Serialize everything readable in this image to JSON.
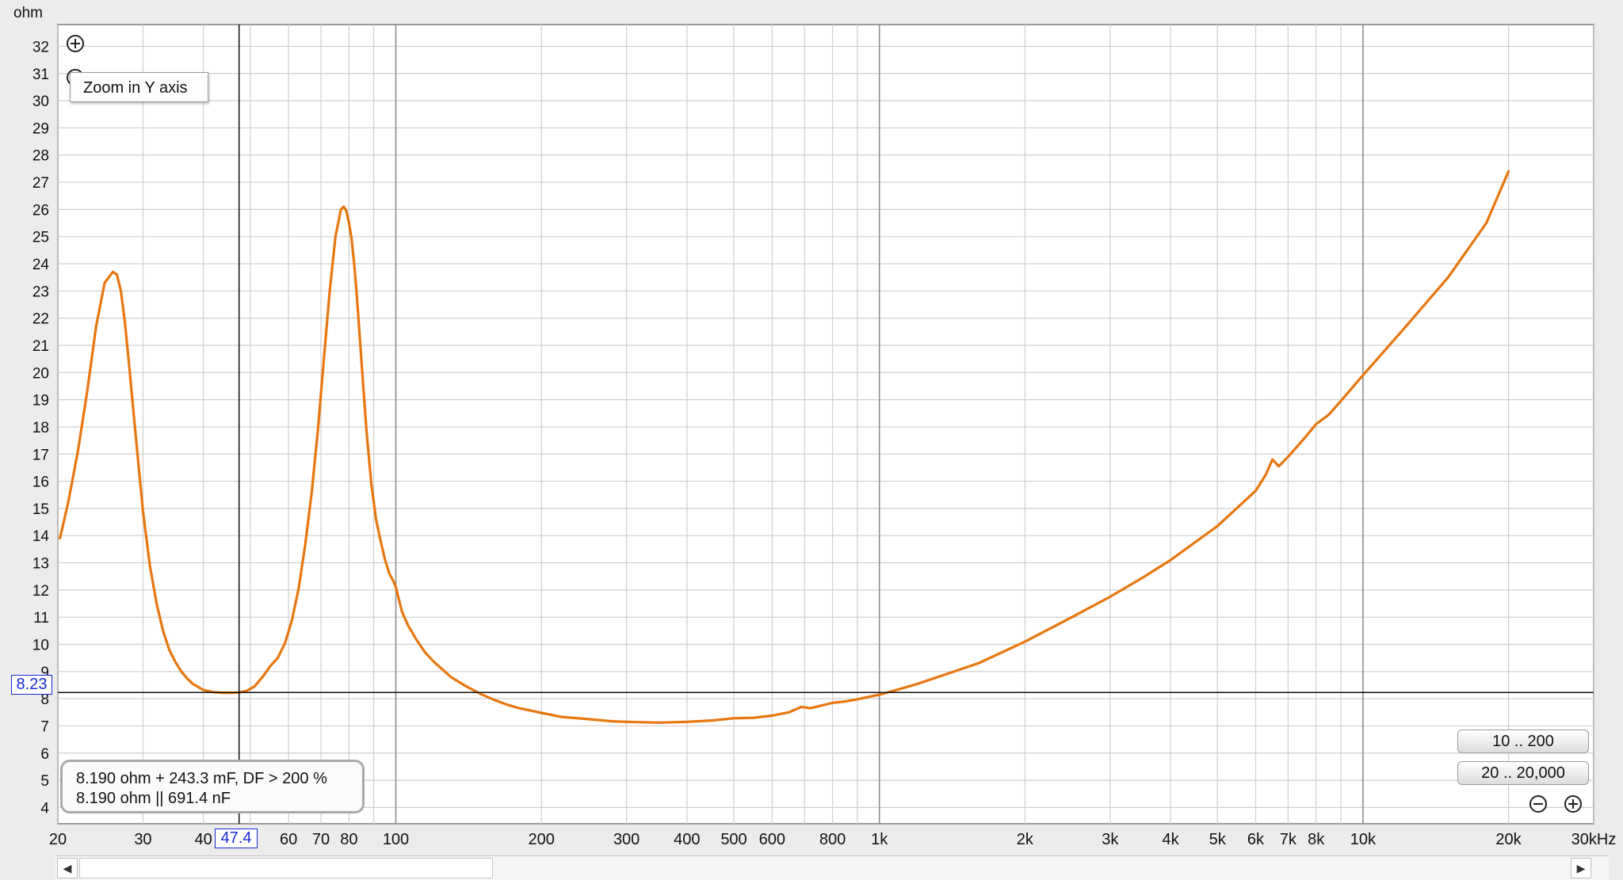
{
  "chart_data": {
    "type": "line",
    "y_unit": "ohm",
    "x_unit": "kHz",
    "x_scale": "log",
    "xlim": [
      20,
      30000
    ],
    "ylim": [
      3.4,
      32.8
    ],
    "grid": true,
    "y_ticks": [
      4,
      5,
      6,
      7,
      8,
      9,
      10,
      11,
      12,
      13,
      14,
      15,
      16,
      17,
      18,
      19,
      20,
      21,
      22,
      23,
      24,
      25,
      26,
      27,
      28,
      29,
      30,
      31,
      32
    ],
    "x_ticks": [
      {
        "value": 20,
        "label": "20"
      },
      {
        "value": 30,
        "label": "30"
      },
      {
        "value": 40,
        "label": "40"
      },
      {
        "value": 60,
        "label": "60"
      },
      {
        "value": 70,
        "label": "70"
      },
      {
        "value": 80,
        "label": "80"
      },
      {
        "value": 100,
        "label": "100"
      },
      {
        "value": 200,
        "label": "200"
      },
      {
        "value": 300,
        "label": "300"
      },
      {
        "value": 400,
        "label": "400"
      },
      {
        "value": 500,
        "label": "500"
      },
      {
        "value": 600,
        "label": "600"
      },
      {
        "value": 800,
        "label": "800"
      },
      {
        "value": 1000,
        "label": "1k"
      },
      {
        "value": 2000,
        "label": "2k"
      },
      {
        "value": 3000,
        "label": "3k"
      },
      {
        "value": 4000,
        "label": "4k"
      },
      {
        "value": 5000,
        "label": "5k"
      },
      {
        "value": 6000,
        "label": "6k"
      },
      {
        "value": 7000,
        "label": "7k"
      },
      {
        "value": 8000,
        "label": "8k"
      },
      {
        "value": 10000,
        "label": "10k"
      },
      {
        "value": 20000,
        "label": "20k"
      },
      {
        "value": 30000,
        "label": "30kHz"
      }
    ],
    "series": [
      {
        "color": "#e8760f",
        "x": [
          20.2,
          21,
          22,
          23,
          24,
          25,
          26,
          26.5,
          27,
          27.5,
          28,
          29,
          30,
          31,
          32,
          33,
          34,
          35,
          36,
          37,
          38,
          40,
          42,
          44,
          46,
          47.4,
          49,
          51,
          53,
          55,
          57,
          59,
          61,
          63,
          65,
          67,
          69,
          71,
          73,
          75,
          77,
          78,
          79,
          80,
          81,
          82,
          83,
          85,
          87,
          89,
          91,
          93,
          95,
          97,
          99,
          100,
          103,
          106,
          110,
          115,
          120,
          130,
          140,
          150,
          160,
          170,
          180,
          200,
          220,
          250,
          280,
          300,
          350,
          400,
          450,
          500,
          550,
          600,
          650,
          690,
          720,
          760,
          800,
          850,
          900,
          1000,
          1100,
          1200,
          1400,
          1600,
          2000,
          2500,
          3000,
          3500,
          4000,
          5000,
          6000,
          6300,
          6500,
          6700,
          7000,
          7500,
          8000,
          8500,
          9000,
          10000,
          12000,
          15000,
          18000,
          20000
        ],
        "y": [
          13.9,
          15.2,
          17.1,
          19.3,
          21.7,
          23.3,
          23.7,
          23.6,
          23.0,
          21.9,
          20.5,
          17.6,
          14.9,
          12.9,
          11.5,
          10.5,
          9.8,
          9.35,
          9.0,
          8.75,
          8.55,
          8.32,
          8.24,
          8.22,
          8.22,
          8.23,
          8.28,
          8.45,
          8.8,
          9.2,
          9.5,
          10.05,
          10.9,
          12.1,
          13.7,
          15.6,
          17.9,
          20.5,
          23.0,
          25.0,
          26.0,
          26.1,
          25.95,
          25.5,
          24.9,
          24.0,
          22.9,
          20.3,
          17.8,
          15.9,
          14.6,
          13.8,
          13.1,
          12.6,
          12.3,
          12.1,
          11.2,
          10.7,
          10.2,
          9.7,
          9.35,
          8.8,
          8.45,
          8.17,
          7.95,
          7.78,
          7.65,
          7.48,
          7.33,
          7.25,
          7.17,
          7.15,
          7.12,
          7.15,
          7.2,
          7.28,
          7.3,
          7.38,
          7.5,
          7.7,
          7.65,
          7.75,
          7.85,
          7.9,
          7.98,
          8.15,
          8.35,
          8.55,
          8.95,
          9.3,
          10.1,
          11.0,
          11.75,
          12.45,
          13.1,
          14.35,
          15.65,
          16.25,
          16.8,
          16.55,
          16.9,
          17.5,
          18.1,
          18.45,
          18.95,
          19.9,
          21.5,
          23.5,
          25.5,
          27.4
        ]
      }
    ],
    "cursor": {
      "x": 47.4,
      "y": 8.23,
      "x_label": "47.4",
      "y_label": "8.23"
    }
  },
  "tooltip": {
    "text": "Zoom in Y axis"
  },
  "info_box": {
    "line1": "8.190 ohm + 243.3 mF, DF > 200 %",
    "line2": "8.190 ohm || 691.4 nF"
  },
  "buttons": {
    "range_a": "10 .. 200",
    "range_b": "20 .. 20,000"
  },
  "icons": {
    "zoom_in": "zoom-in-icon",
    "zoom_out": "zoom-out-icon",
    "scroll_left": "arrow-left-icon",
    "scroll_right": "arrow-right-icon"
  },
  "colors": {
    "curve": "#e8760f",
    "cursor_label": "#1a2bd6",
    "background": "#ececec",
    "plot_background": "#ffffff"
  }
}
